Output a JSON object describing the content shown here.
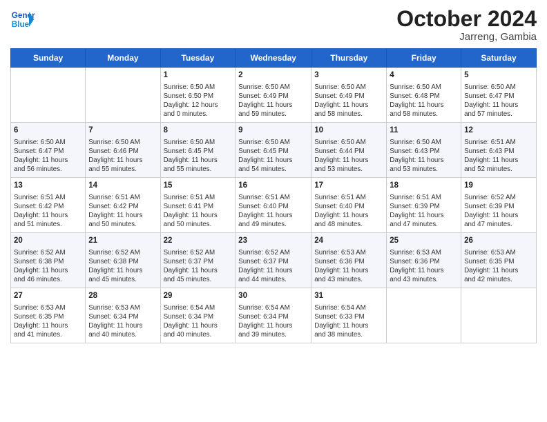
{
  "header": {
    "logo_line1": "General",
    "logo_line2": "Blue",
    "month": "October 2024",
    "location": "Jarreng, Gambia"
  },
  "weekdays": [
    "Sunday",
    "Monday",
    "Tuesday",
    "Wednesday",
    "Thursday",
    "Friday",
    "Saturday"
  ],
  "weeks": [
    [
      {
        "day": "",
        "info": ""
      },
      {
        "day": "",
        "info": ""
      },
      {
        "day": "1",
        "info": "Sunrise: 6:50 AM\nSunset: 6:50 PM\nDaylight: 12 hours\nand 0 minutes."
      },
      {
        "day": "2",
        "info": "Sunrise: 6:50 AM\nSunset: 6:49 PM\nDaylight: 11 hours\nand 59 minutes."
      },
      {
        "day": "3",
        "info": "Sunrise: 6:50 AM\nSunset: 6:49 PM\nDaylight: 11 hours\nand 58 minutes."
      },
      {
        "day": "4",
        "info": "Sunrise: 6:50 AM\nSunset: 6:48 PM\nDaylight: 11 hours\nand 58 minutes."
      },
      {
        "day": "5",
        "info": "Sunrise: 6:50 AM\nSunset: 6:47 PM\nDaylight: 11 hours\nand 57 minutes."
      }
    ],
    [
      {
        "day": "6",
        "info": "Sunrise: 6:50 AM\nSunset: 6:47 PM\nDaylight: 11 hours\nand 56 minutes."
      },
      {
        "day": "7",
        "info": "Sunrise: 6:50 AM\nSunset: 6:46 PM\nDaylight: 11 hours\nand 55 minutes."
      },
      {
        "day": "8",
        "info": "Sunrise: 6:50 AM\nSunset: 6:45 PM\nDaylight: 11 hours\nand 55 minutes."
      },
      {
        "day": "9",
        "info": "Sunrise: 6:50 AM\nSunset: 6:45 PM\nDaylight: 11 hours\nand 54 minutes."
      },
      {
        "day": "10",
        "info": "Sunrise: 6:50 AM\nSunset: 6:44 PM\nDaylight: 11 hours\nand 53 minutes."
      },
      {
        "day": "11",
        "info": "Sunrise: 6:50 AM\nSunset: 6:43 PM\nDaylight: 11 hours\nand 53 minutes."
      },
      {
        "day": "12",
        "info": "Sunrise: 6:51 AM\nSunset: 6:43 PM\nDaylight: 11 hours\nand 52 minutes."
      }
    ],
    [
      {
        "day": "13",
        "info": "Sunrise: 6:51 AM\nSunset: 6:42 PM\nDaylight: 11 hours\nand 51 minutes."
      },
      {
        "day": "14",
        "info": "Sunrise: 6:51 AM\nSunset: 6:42 PM\nDaylight: 11 hours\nand 50 minutes."
      },
      {
        "day": "15",
        "info": "Sunrise: 6:51 AM\nSunset: 6:41 PM\nDaylight: 11 hours\nand 50 minutes."
      },
      {
        "day": "16",
        "info": "Sunrise: 6:51 AM\nSunset: 6:40 PM\nDaylight: 11 hours\nand 49 minutes."
      },
      {
        "day": "17",
        "info": "Sunrise: 6:51 AM\nSunset: 6:40 PM\nDaylight: 11 hours\nand 48 minutes."
      },
      {
        "day": "18",
        "info": "Sunrise: 6:51 AM\nSunset: 6:39 PM\nDaylight: 11 hours\nand 47 minutes."
      },
      {
        "day": "19",
        "info": "Sunrise: 6:52 AM\nSunset: 6:39 PM\nDaylight: 11 hours\nand 47 minutes."
      }
    ],
    [
      {
        "day": "20",
        "info": "Sunrise: 6:52 AM\nSunset: 6:38 PM\nDaylight: 11 hours\nand 46 minutes."
      },
      {
        "day": "21",
        "info": "Sunrise: 6:52 AM\nSunset: 6:38 PM\nDaylight: 11 hours\nand 45 minutes."
      },
      {
        "day": "22",
        "info": "Sunrise: 6:52 AM\nSunset: 6:37 PM\nDaylight: 11 hours\nand 45 minutes."
      },
      {
        "day": "23",
        "info": "Sunrise: 6:52 AM\nSunset: 6:37 PM\nDaylight: 11 hours\nand 44 minutes."
      },
      {
        "day": "24",
        "info": "Sunrise: 6:53 AM\nSunset: 6:36 PM\nDaylight: 11 hours\nand 43 minutes."
      },
      {
        "day": "25",
        "info": "Sunrise: 6:53 AM\nSunset: 6:36 PM\nDaylight: 11 hours\nand 43 minutes."
      },
      {
        "day": "26",
        "info": "Sunrise: 6:53 AM\nSunset: 6:35 PM\nDaylight: 11 hours\nand 42 minutes."
      }
    ],
    [
      {
        "day": "27",
        "info": "Sunrise: 6:53 AM\nSunset: 6:35 PM\nDaylight: 11 hours\nand 41 minutes."
      },
      {
        "day": "28",
        "info": "Sunrise: 6:53 AM\nSunset: 6:34 PM\nDaylight: 11 hours\nand 40 minutes."
      },
      {
        "day": "29",
        "info": "Sunrise: 6:54 AM\nSunset: 6:34 PM\nDaylight: 11 hours\nand 40 minutes."
      },
      {
        "day": "30",
        "info": "Sunrise: 6:54 AM\nSunset: 6:34 PM\nDaylight: 11 hours\nand 39 minutes."
      },
      {
        "day": "31",
        "info": "Sunrise: 6:54 AM\nSunset: 6:33 PM\nDaylight: 11 hours\nand 38 minutes."
      },
      {
        "day": "",
        "info": ""
      },
      {
        "day": "",
        "info": ""
      }
    ]
  ]
}
